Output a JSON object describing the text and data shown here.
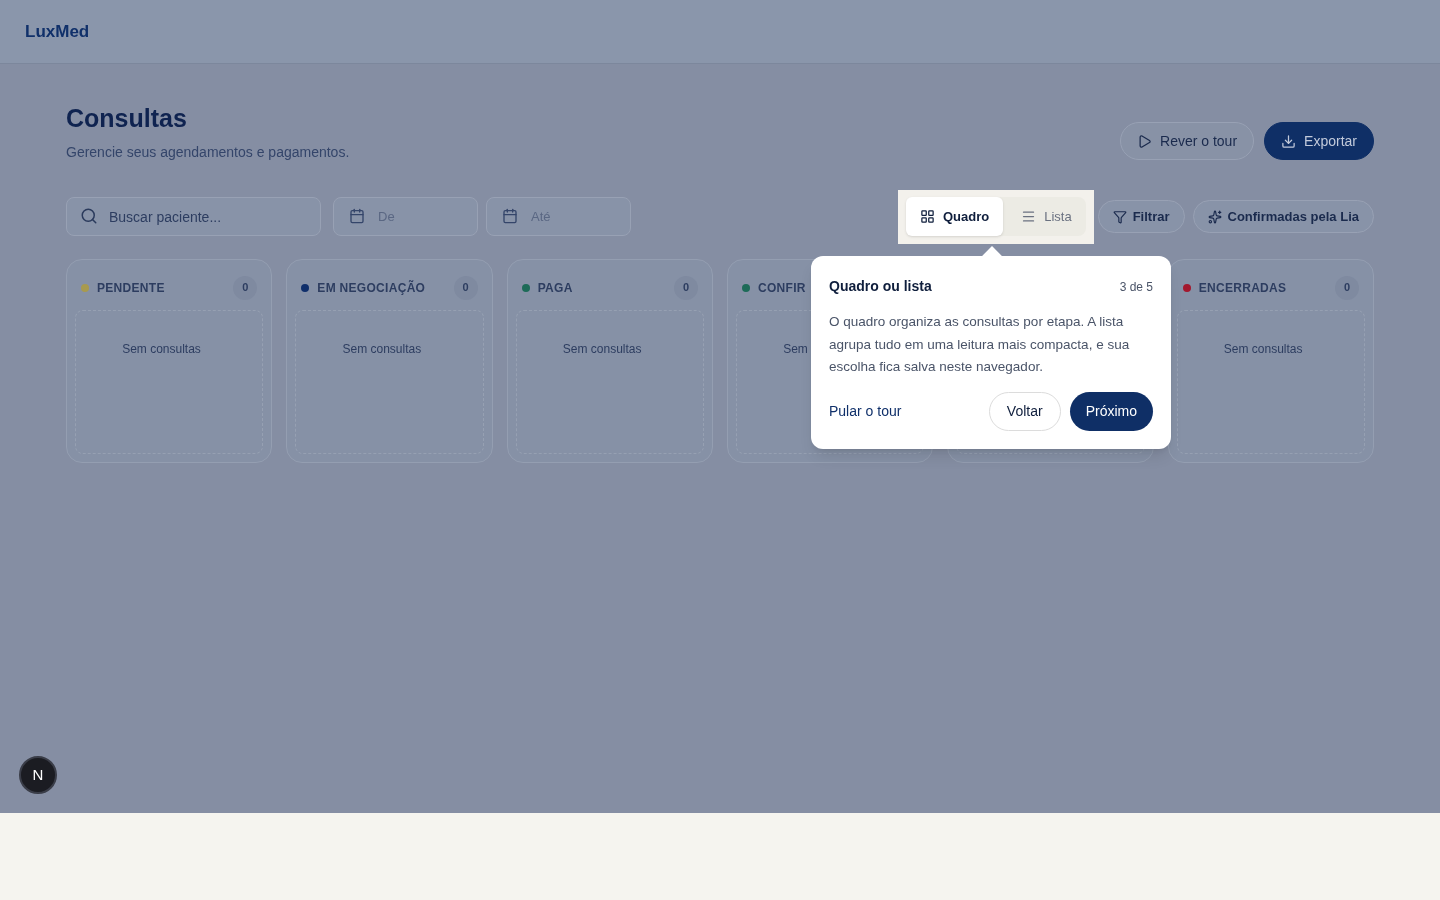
{
  "brand": "LuxMed",
  "page": {
    "title": "Consultas",
    "subtitle": "Gerencie seus agendamentos e pagamentos."
  },
  "actions": [
    {
      "label": "Rever o tour",
      "kind": "outline"
    },
    {
      "label": "Exportar",
      "kind": "primary"
    }
  ],
  "search": {
    "placeholder": "Buscar paciente..."
  },
  "date_from": {
    "placeholder": "De"
  },
  "date_to": {
    "placeholder": "Até"
  },
  "view_toggle": [
    {
      "label": "Quadro",
      "kind": "board",
      "selected": true
    },
    {
      "label": "Lista",
      "kind": "list",
      "selected": false
    }
  ],
  "filters": [
    {
      "label": "Filtrar",
      "kind": "filter"
    },
    {
      "label": "Confirmadas pela Lia",
      "kind": "sparkle"
    }
  ],
  "columns": [
    {
      "title": "PENDENTE",
      "color": "#a89a4e",
      "count": "0",
      "empty": "Sem consultas"
    },
    {
      "title": "EM NEGOCIAÇÃO",
      "color": "#102f6b",
      "count": "0",
      "empty": "Sem consultas"
    },
    {
      "title": "PAGA",
      "color": "#1d6b58",
      "count": "0",
      "empty": "Sem consultas"
    },
    {
      "title": "CONFIR",
      "color": "#1d6b58",
      "empty": "Sem"
    },
    {},
    {
      "title": "ENCERRADAS",
      "color": "#a3182e",
      "count": "0",
      "empty": "Sem consultas"
    }
  ],
  "tour": {
    "title": "Quadro ou lista",
    "step": "3 de 5",
    "body": "O quadro organiza as consultas por etapa. A lista agrupa tudo em uma leitura mais compacta, e sua escolha fica salva neste navegador.",
    "skip": "Pular o tour",
    "back": "Voltar",
    "next": "Próximo"
  },
  "dev_badge": "N"
}
